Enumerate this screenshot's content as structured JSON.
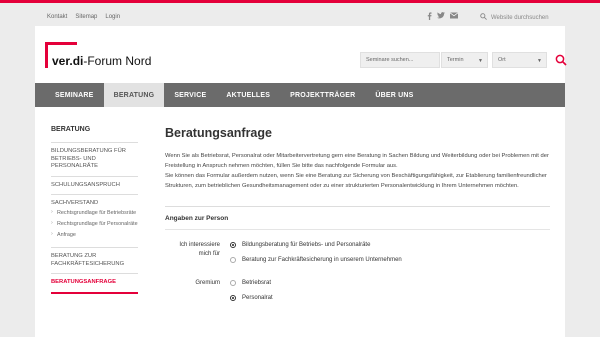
{
  "colors": {
    "brand": "#e4003a",
    "nav_bg": "#6b6b6b",
    "nav_active_bg": "#e2e2e2"
  },
  "topbar": {
    "links": [
      "Kontakt",
      "Sitemap",
      "Login"
    ],
    "social_icons": [
      "facebook-icon",
      "twitter-icon",
      "mail-icon"
    ],
    "site_search": "Website durchsuchen"
  },
  "header": {
    "logo_bold": "ver.di",
    "logo_rest": "-Forum Nord",
    "search_placeholder": "Seminare suchen...",
    "termin": "Termin",
    "ort": "Ort"
  },
  "nav": {
    "items": [
      "SEMINARE",
      "BERATUNG",
      "SERVICE",
      "AKTUELLES",
      "PROJEKTTRÄGER",
      "ÜBER UNS"
    ],
    "active": "BERATUNG"
  },
  "sidebar": {
    "title": "BERATUNG",
    "item1": "BILDUNGSBERATUNG FÜR BETRIEBS- UND PERSONALRÄTE",
    "item2": "SCHULUNGSANSPRUCH",
    "group_title": "SACHVERSTAND",
    "sub1": "Rechtsgrundlage für Betriebsräte",
    "sub2": "Rechtsgrundlage für Personalräte",
    "sub3": "Anfrage",
    "item3": "BERATUNG ZUR FACHKRÄFTESICHERUNG",
    "item4": "BERATUNGSANFRAGE"
  },
  "main": {
    "title": "Beratungsanfrage",
    "intro1": "Wenn Sie als Betriebsrat, Personalrat oder Mitarbeitervertretung gern eine Beratung in Sachen Bildung und Weiterbildung oder bei Problemen mit der Freistellung in Anspruch nehmen möchten, füllen Sie bitte das nachfolgende Formular aus.",
    "intro2": "Sie können das Formular außerdem nutzen, wenn Sie eine Beratung zur Sicherung von Beschäftigungsfähigkeit, zur Etablierung familienfreundlicher Strukturen, zum betrieblichen Gesundheitsmanagement oder zu einer strukturierten Personalentwicklung in Ihrem Unternehmen möchten.",
    "section": "Angaben zur Person",
    "interest_label": "Ich interessiere mich für",
    "interest_opt1": "Bildungsberatung für Betriebs- und Personalräte",
    "interest_opt2": "Beratung zur Fachkräftesicherung in unserem Unternehmen",
    "gremium_label": "Gremium",
    "gremium_opt1": "Betriebsrat",
    "gremium_opt2": "Personalrat"
  }
}
